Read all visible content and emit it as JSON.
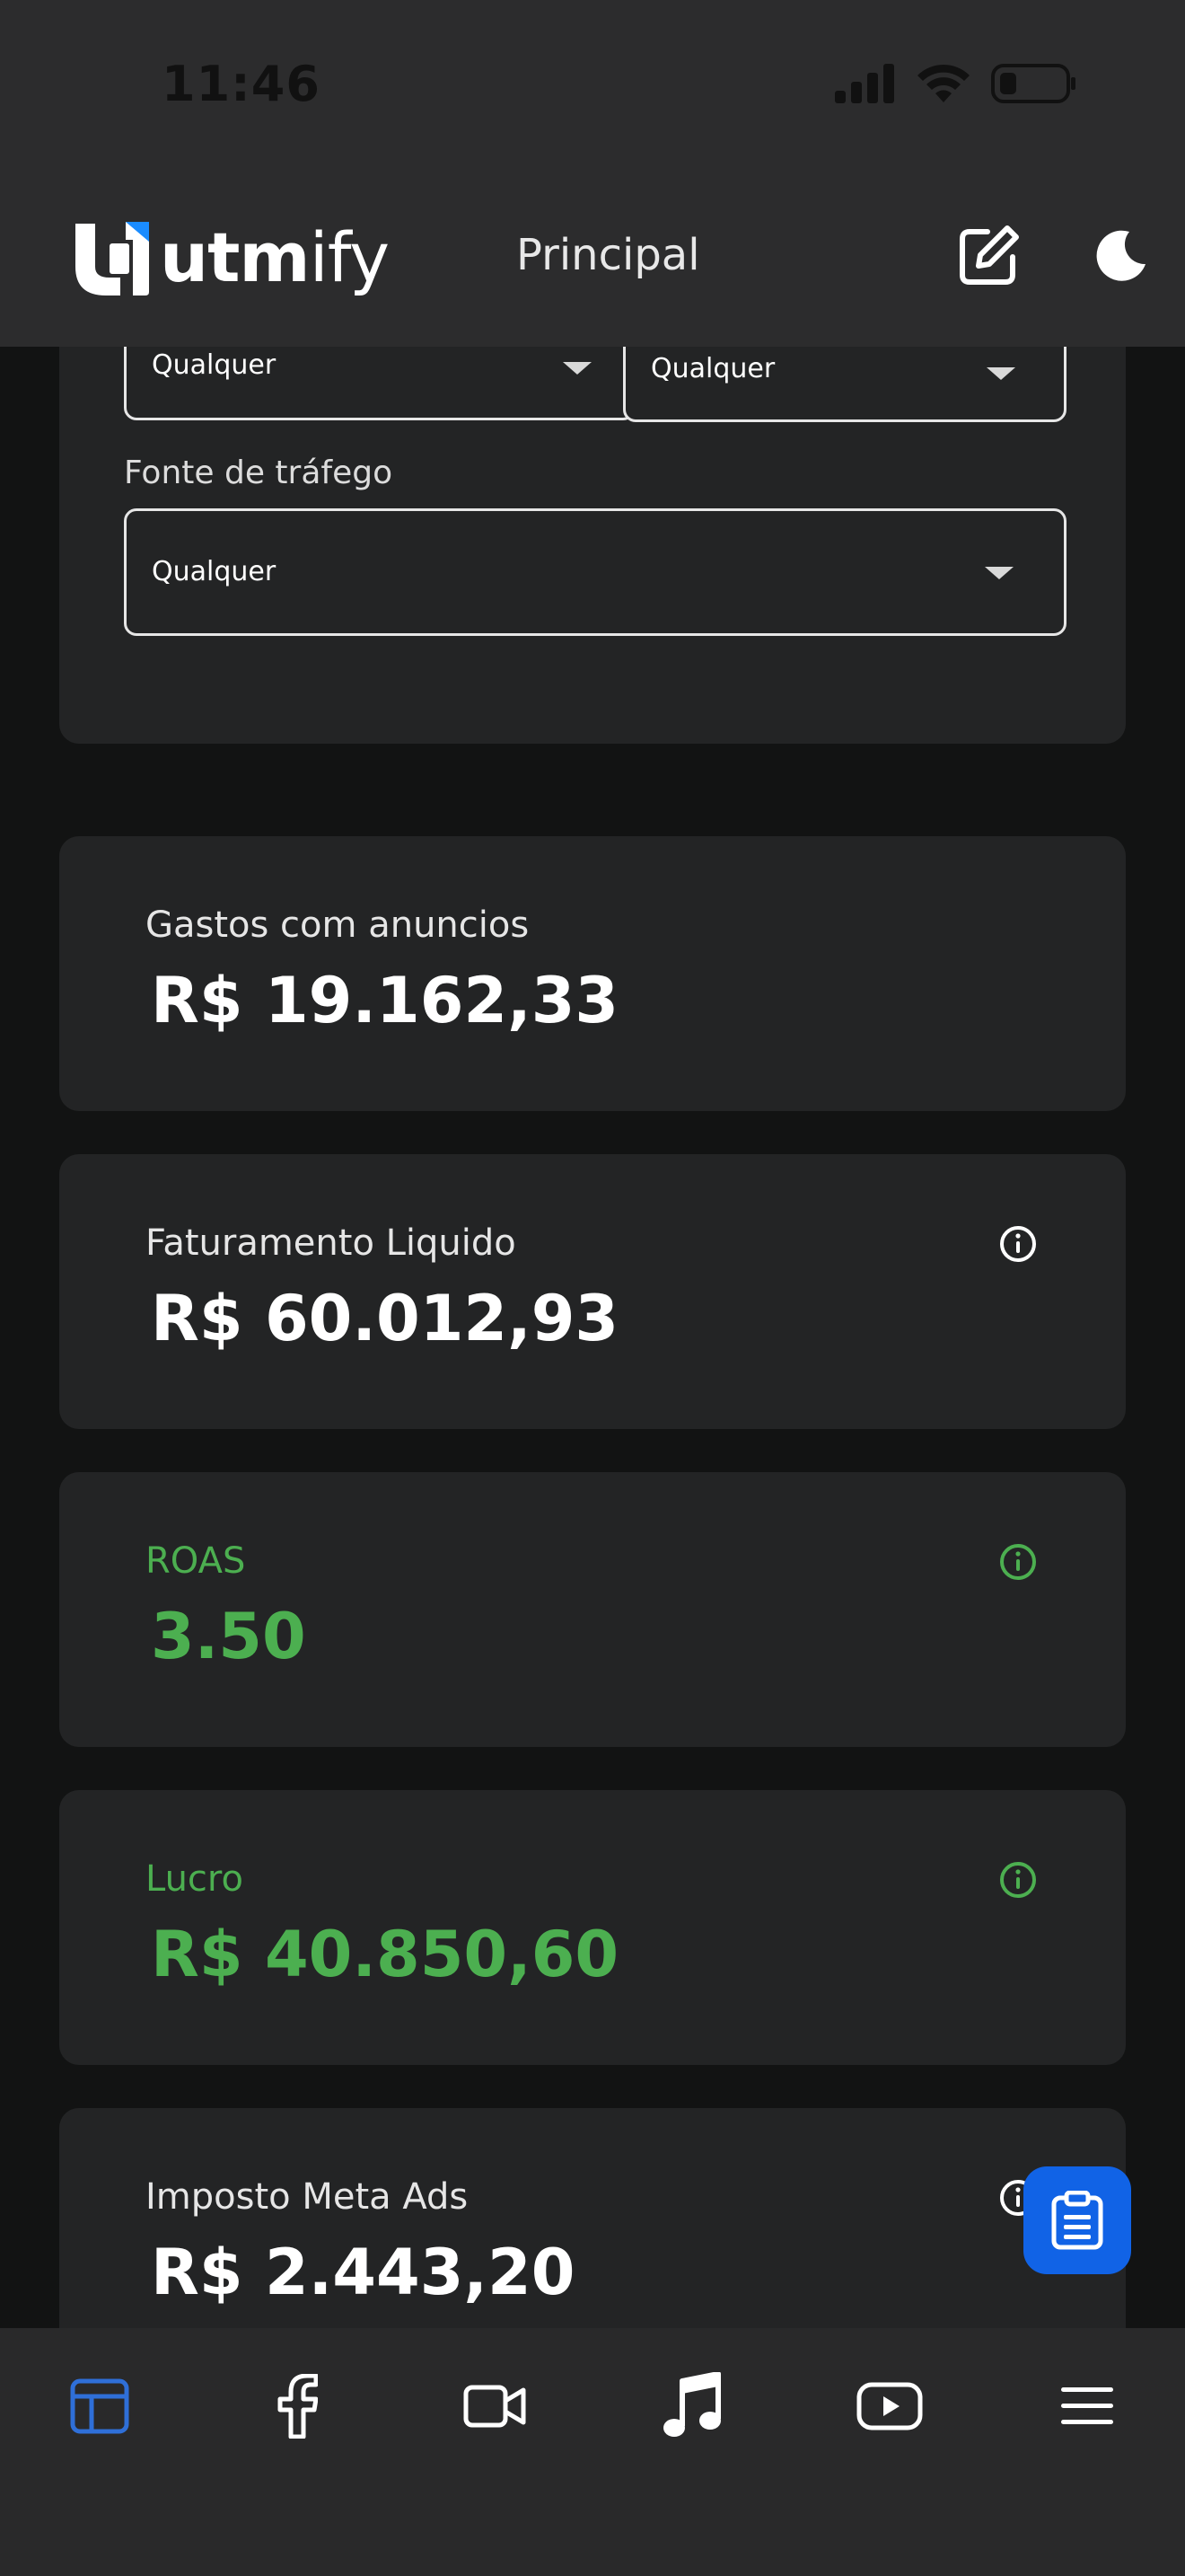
{
  "status_bar": {
    "time": "11:46"
  },
  "header": {
    "logo_bold": "utm",
    "logo_light": "ify",
    "title": "Principal"
  },
  "filters": {
    "select_left_value": "Qualquer",
    "select_right_value": "Qualquer",
    "traffic_source_label": "Fonte de tráfego",
    "traffic_source_value": "Qualquer"
  },
  "metrics": [
    {
      "label": "Gastos com anuncios",
      "value": "R$ 19.162,33"
    },
    {
      "label": "Faturamento Liquido",
      "value": "R$ 60.012,93"
    },
    {
      "label": "ROAS",
      "value": "3.50"
    },
    {
      "label": "Lucro",
      "value": "R$ 40.850,60"
    },
    {
      "label": "Imposto Meta Ads",
      "value": "R$ 2.443,20"
    }
  ],
  "icons": {
    "signal": "cellular-signal-icon",
    "wifi": "wifi-icon",
    "battery": "battery-icon",
    "edit": "edit-icon",
    "theme": "moon-icon",
    "info": "info-icon",
    "fab": "clipboard-icon",
    "nav": [
      "dashboard-icon",
      "facebook-icon",
      "video-camera-icon",
      "music-note-icon",
      "youtube-icon",
      "menu-icon"
    ]
  },
  "colors": {
    "accent_blue": "#1163e6",
    "positive_green": "#4caf50",
    "card_bg": "#232425",
    "page_bg": "#121313"
  }
}
